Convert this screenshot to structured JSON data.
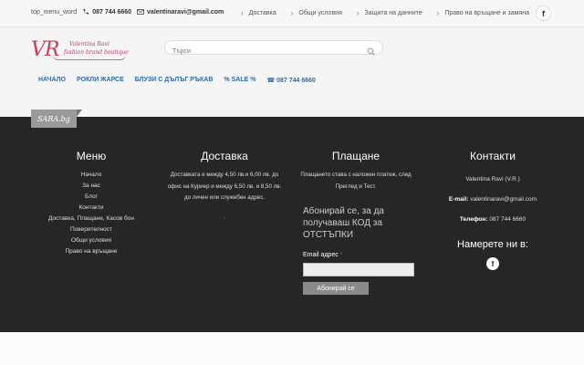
{
  "topbar": {
    "word": "top_menu_word",
    "phone": "087 744 6660",
    "email": "valentinaravi@gmail.com",
    "links": [
      "Доставка",
      "Общи условия",
      "Защита на данните",
      "Право на връщане и замяна"
    ],
    "social": "f"
  },
  "header": {
    "logo_mark": "VR",
    "logo_name": "Valentina Ravi",
    "logo_tag": "fashion brand boutique",
    "search_placeholder": "Търси",
    "nav": [
      "НАЧАЛО",
      "РОКЛИ ЖАРСЕ",
      "БЛУЗИ С ДЪЛЪГ РЪКАВ",
      "% SALE %",
      "☎ 087 744 6660"
    ]
  },
  "footer": {
    "badge": "SARA.bg",
    "menu_title": "Меню",
    "menu_items": [
      "Начало",
      "За нас",
      "Блог",
      "Контакти",
      "Доставка, Плащане, Касов бон",
      "Поверителност",
      "Общи условия",
      "Право на връщане"
    ],
    "delivery_title": "Доставка",
    "delivery_text": [
      "Доставката е между 4,50 лв.и 6,00 лв. до",
      "офис на Куриер и между 6,50 лв. и 8,50 лв.",
      "до личен или служебен адрес."
    ],
    "delivery_dot": "-",
    "payment_title": "Плащане",
    "payment_text": [
      "Плащането става с наложен платеж, след",
      "Преглед и Тест."
    ],
    "subscribe_text": [
      "Абонирай се, за да",
      "получаваш КОД за",
      "ОТСТЪПКИ"
    ],
    "email_label": "Email адрес",
    "required_mark": "*",
    "subscribe_btn": "Абонирай се",
    "contacts_title": "Контакти",
    "contact_name": "Valentina Ravi (V.R.)",
    "contact_email_label": "E-mail:",
    "contact_email": "valentinaravi@gmail.com",
    "contact_phone_label": "Телефон:",
    "contact_phone": "087 744 6660",
    "find_us": "Намерете ни в:",
    "social": "f"
  }
}
